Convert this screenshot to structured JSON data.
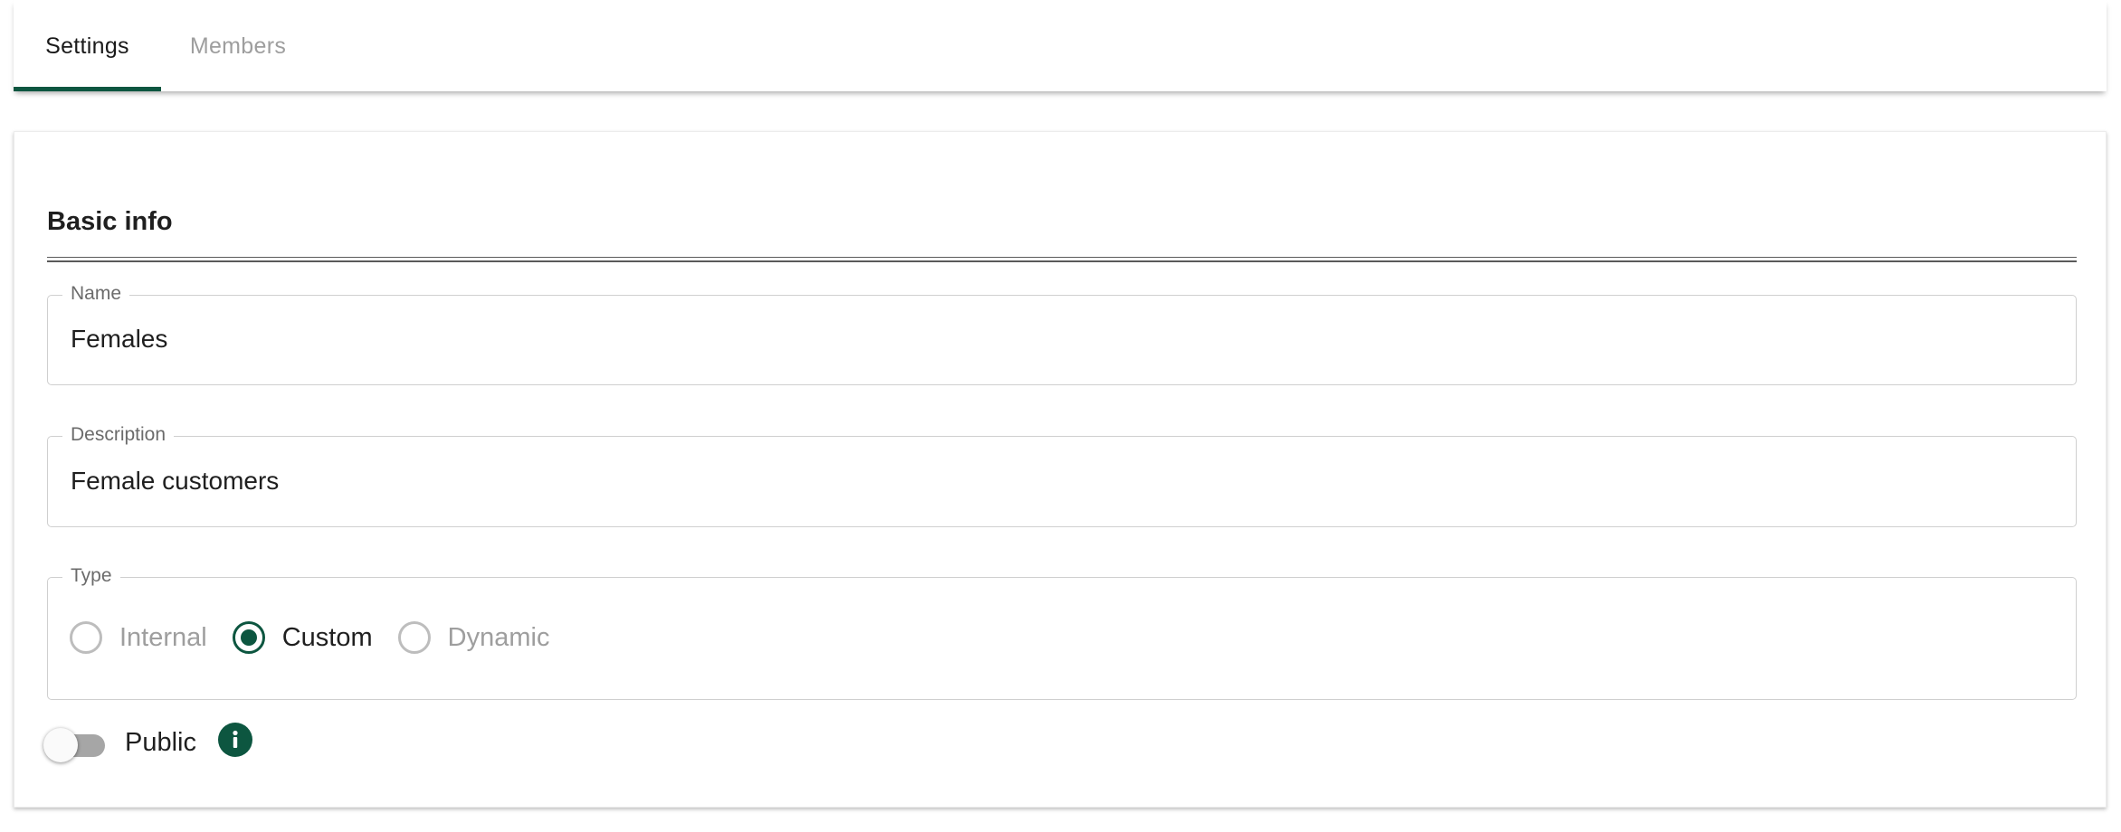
{
  "tabs": [
    {
      "label": "Settings",
      "active": true
    },
    {
      "label": "Members",
      "active": false
    }
  ],
  "section": {
    "title": "Basic info"
  },
  "fields": {
    "name": {
      "label": "Name",
      "value": "Females"
    },
    "description": {
      "label": "Description",
      "value": "Female customers"
    },
    "type": {
      "label": "Type",
      "options": [
        {
          "label": "Internal",
          "selected": false
        },
        {
          "label": "Custom",
          "selected": true
        },
        {
          "label": "Dynamic",
          "selected": false
        }
      ],
      "selected": "Custom"
    }
  },
  "public_toggle": {
    "label": "Public",
    "on": false,
    "info_icon": "info-icon"
  },
  "colors": {
    "accent": "#0d5640",
    "inactive_text": "#9e9e9e",
    "border": "#cfcfcf"
  }
}
